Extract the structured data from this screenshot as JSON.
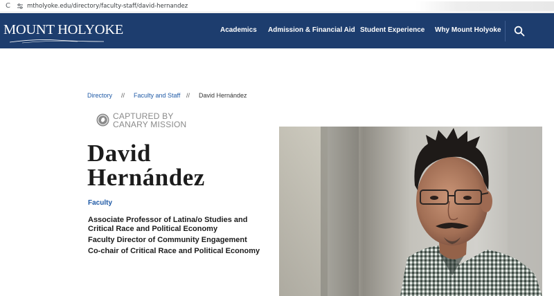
{
  "browser": {
    "url": "mtholyoke.edu/directory/faculty-staff/david-hernandez",
    "reload_glyph": "C"
  },
  "header": {
    "logo_text": "MOUNT HOLYOKE",
    "brand_color": "#1d3d6e",
    "nav": [
      {
        "label": "Academics"
      },
      {
        "label": "Admission & Financial Aid"
      },
      {
        "label": "Student Experience"
      },
      {
        "label": "Why Mount Holyoke"
      }
    ]
  },
  "breadcrumb": {
    "items": [
      "Directory",
      "Faculty and Staff",
      "David Hernández"
    ],
    "separator": "//"
  },
  "stamp": {
    "line1": "CAPTURED BY",
    "line2": "CANARY MISSION"
  },
  "profile": {
    "first_name": "David",
    "last_name": "Hernández",
    "category": "Faculty",
    "titles": [
      "Associate Professor of Latina/o Studies and Critical Race and Political Economy",
      "Faculty Director of Community Engagement",
      "Co-chair of Critical Race and Political Economy"
    ]
  }
}
